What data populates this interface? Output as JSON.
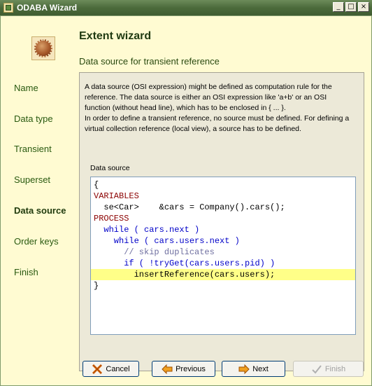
{
  "window": {
    "title": "ODABA Wizard"
  },
  "header": {
    "title": "Extent wizard",
    "subtitle": "Data source for transient reference"
  },
  "nav": {
    "items": [
      {
        "label": "Name",
        "active": false
      },
      {
        "label": "Data type",
        "active": false
      },
      {
        "label": "Transient",
        "active": false
      },
      {
        "label": "Superset",
        "active": false
      },
      {
        "label": "Data source",
        "active": true
      },
      {
        "label": "Order keys",
        "active": false
      },
      {
        "label": "Finish",
        "active": false
      }
    ]
  },
  "content": {
    "description_lines": [
      "A data source (OSI expression) might be defined as computation rule for the",
      "reference. The data source is either an OSI expression like 'a+b' or an OSI",
      "function (without head line), which has to be enclosed in { ... }.",
      "In order to define a transient reference, no source must be defined. For defining a",
      "virtual collection reference (local view), a source has to be defined."
    ],
    "data_source_label": "Data source",
    "code_lines": [
      "{",
      "VARIABLES",
      "  se<Car>    &cars = Company().cars();",
      "PROCESS",
      "  while ( cars.next )",
      "    while ( cars.users.next )",
      "      // skip duplicates",
      "      if ( !tryGet(cars.users.pid) )",
      "        insertReference(cars.users);",
      "}"
    ]
  },
  "buttons": {
    "cancel": "Cancel",
    "previous": "Previous",
    "next": "Next",
    "finish": "Finish"
  },
  "colors": {
    "title_bar": "#4c6b3c",
    "wizard_background": "#fffbd2",
    "keyword_red": "#8b0000",
    "keyword_blue": "#0000c8",
    "highlight_line": "#ffff88"
  },
  "icons": {
    "app": "odaba-app-icon",
    "header": "extent-ball-icon",
    "cancel": "cancel-x-icon",
    "previous": "arrow-left-icon",
    "next": "arrow-right-icon",
    "finish": "checkmark-icon"
  }
}
